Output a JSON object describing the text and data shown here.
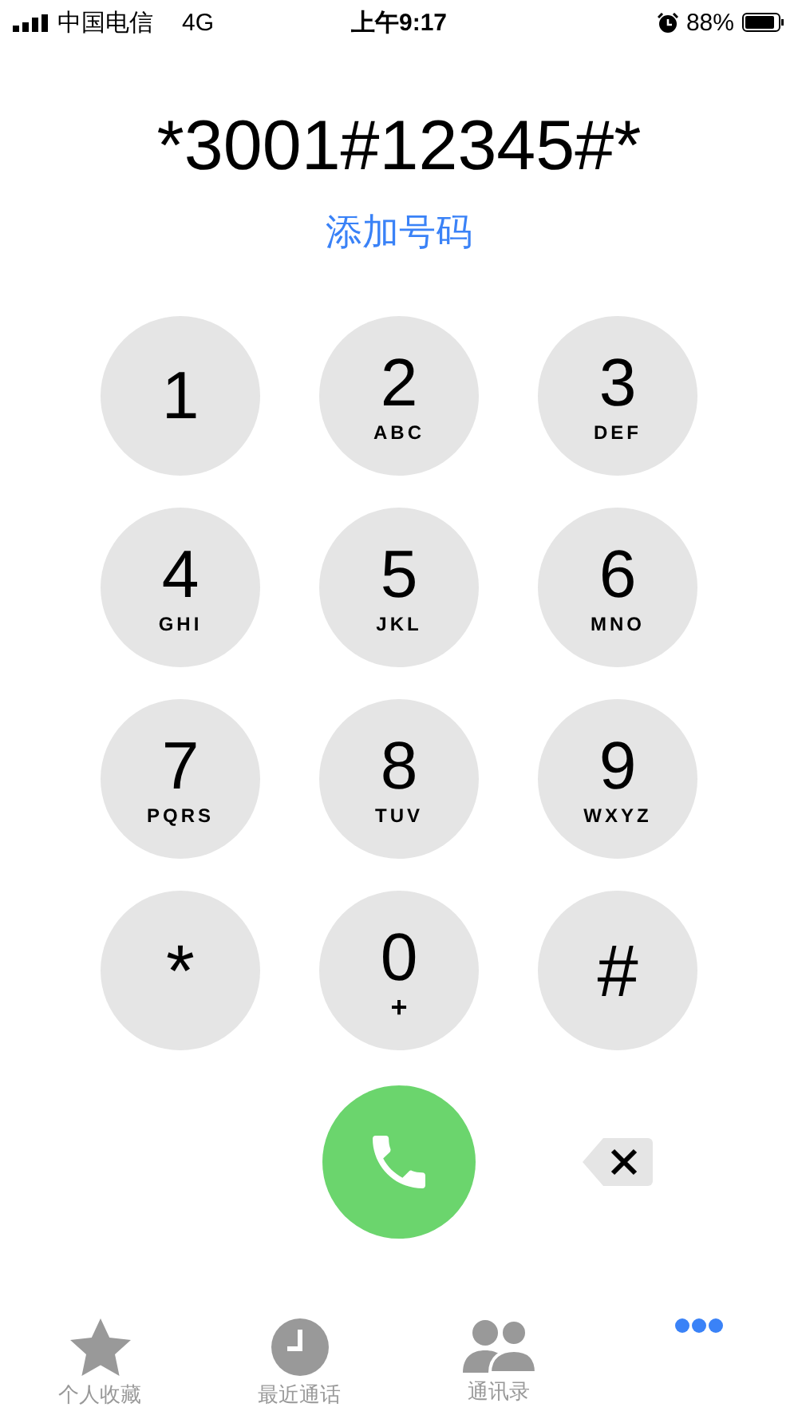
{
  "status_bar": {
    "carrier": "中国电信",
    "network": "4G",
    "time": "上午9:17",
    "battery": "88%"
  },
  "dialed_number": "*3001#12345#*",
  "add_number": "添加号码",
  "keys": [
    {
      "digit": "1"
    },
    {
      "digit": "2",
      "letters": "ABC"
    },
    {
      "digit": "3",
      "letters": "DEF"
    },
    {
      "digit": "4",
      "letters": "GHI"
    },
    {
      "digit": "5",
      "letters": "JKL"
    },
    {
      "digit": "6",
      "letters": "MNO"
    },
    {
      "digit": "7",
      "letters": "PQRS"
    },
    {
      "digit": "8",
      "letters": "TUV"
    },
    {
      "digit": "9",
      "letters": "WXYZ"
    },
    {
      "digit": "*"
    },
    {
      "digit": "0",
      "letters": "+"
    },
    {
      "digit": "#"
    }
  ],
  "tabs": [
    {
      "label": "个人收藏",
      "selected": false
    },
    {
      "label": "最近通话",
      "selected": false
    },
    {
      "label": "通讯录",
      "selected": false
    },
    {
      "selected": true
    }
  ]
}
